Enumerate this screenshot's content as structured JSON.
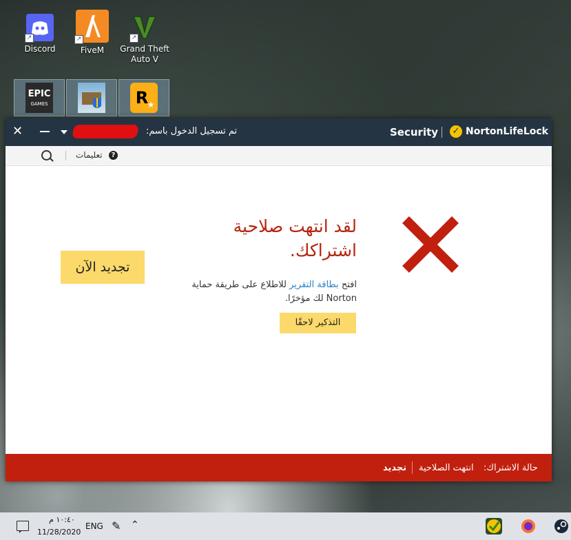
{
  "desktop": {
    "icons": [
      {
        "label": "Discord",
        "icon": "discord-icon"
      },
      {
        "label": "FiveM",
        "icon": "fivem-icon"
      },
      {
        "label": "Grand Theft Auto V",
        "icon": "gta-v-icon"
      }
    ],
    "tiles": [
      {
        "icon": "epic-games-icon",
        "logo_text": "EPIC GAMES"
      },
      {
        "icon": "game-launcher-icon"
      },
      {
        "icon": "rockstar-icon",
        "logo_text": "R"
      }
    ]
  },
  "norton": {
    "titlebar": {
      "signed_in_label": "تم تسجيل الدخول باسم:",
      "product": "Security",
      "brand": "NortonLifeLock"
    },
    "toolbar": {
      "help_label": "تعليمات"
    },
    "main": {
      "headline": "لقد انتهت صلاحية اشتراكك.",
      "description_prefix": "افتح",
      "description_link": "بطاقة التقرير",
      "description_suffix": "للاطلاع على طريقة حماية Norton لك مؤخرًا.",
      "remind_later_button": "التذكير لاحقًا",
      "renew_now_button": "تجديد الآن"
    },
    "statusbar": {
      "subscription_label": "حالة الاشتراك:",
      "subscription_value": "انتهت الصلاحية",
      "renew_link": "تجديد"
    },
    "colors": {
      "accent_red": "#c1200e",
      "button_yellow": "#fbd96a",
      "titlebar": "#253443",
      "link_blue": "#2a82c4"
    }
  },
  "taskbar": {
    "time": "١٠:٤٠ م",
    "date": "11/28/2020",
    "language": "ENG"
  }
}
